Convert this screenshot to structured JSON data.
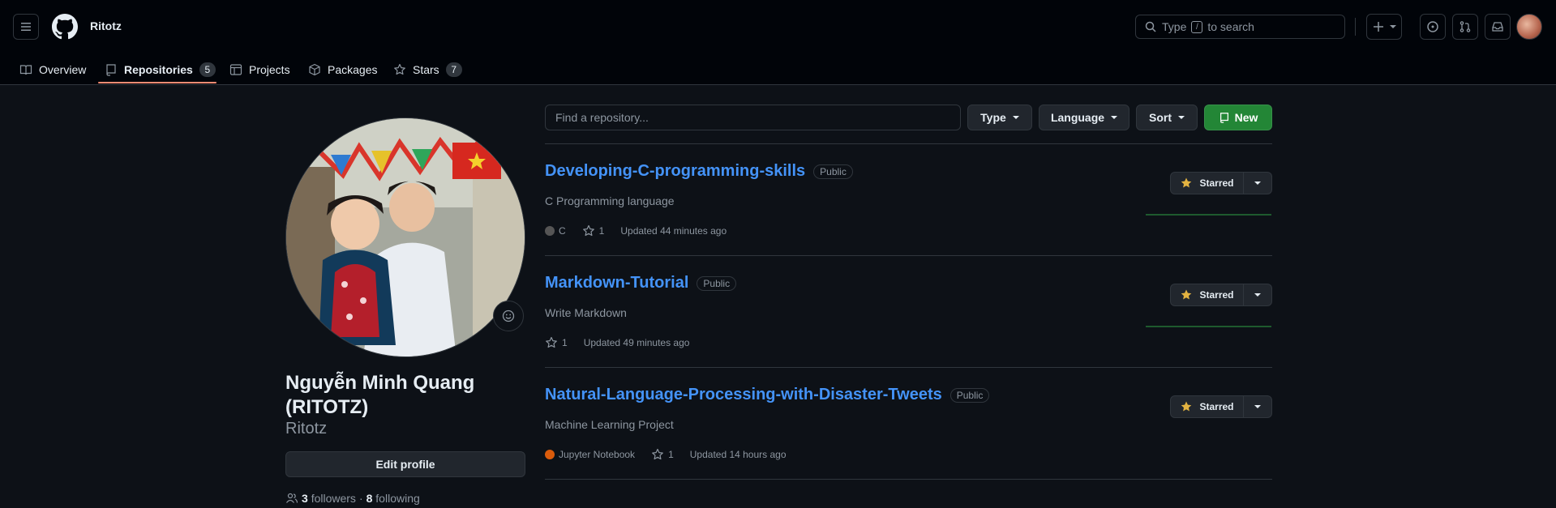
{
  "header": {
    "username": "Ritotz",
    "search": {
      "prefix": "Type",
      "key": "/",
      "suffix": "to search"
    },
    "icons": [
      "menu-icon",
      "github-logo-icon",
      "plus-icon",
      "issue-icon",
      "pull-request-icon",
      "inbox-icon"
    ]
  },
  "tabs": [
    {
      "label": "Overview",
      "icon": "book-icon",
      "count": ""
    },
    {
      "label": "Repositories",
      "icon": "repo-icon",
      "count": "5"
    },
    {
      "label": "Projects",
      "icon": "table-icon",
      "count": ""
    },
    {
      "label": "Packages",
      "icon": "package-icon",
      "count": ""
    },
    {
      "label": "Stars",
      "icon": "star-icon",
      "count": "7"
    }
  ],
  "profile": {
    "fullname": "Nguyễn Minh Quang (RITOTZ)",
    "login": "Ritotz",
    "edit_label": "Edit profile",
    "followers": "3",
    "followers_label": "followers",
    "sep": "·",
    "following": "8",
    "following_label": "following"
  },
  "filters": {
    "find_placeholder": "Find a repository...",
    "type_label": "Type",
    "language_label": "Language",
    "sort_label": "Sort",
    "new_label": "New"
  },
  "repos": [
    {
      "name": "Developing-C-programming-skills",
      "visibility": "Public",
      "description": "C Programming language",
      "language": "C",
      "lang_color": "#555555",
      "stars": "1",
      "updated": "Updated 44 minutes ago",
      "star_label": "Starred"
    },
    {
      "name": "Markdown-Tutorial",
      "visibility": "Public",
      "description": "Write Markdown",
      "language": "",
      "lang_color": "",
      "stars": "1",
      "updated": "Updated 49 minutes ago",
      "star_label": "Starred"
    },
    {
      "name": "Natural-Language-Processing-with-Disaster-Tweets",
      "visibility": "Public",
      "description": "Machine Learning Project",
      "language": "Jupyter Notebook",
      "lang_color": "#DA5B0B",
      "stars": "1",
      "updated": "Updated 14 hours ago",
      "star_label": "Starred"
    }
  ],
  "colors": {
    "accent": "#4493f8",
    "tab_underline": "#fd8c73",
    "new_button": "#238636",
    "star": "#e3b341"
  }
}
